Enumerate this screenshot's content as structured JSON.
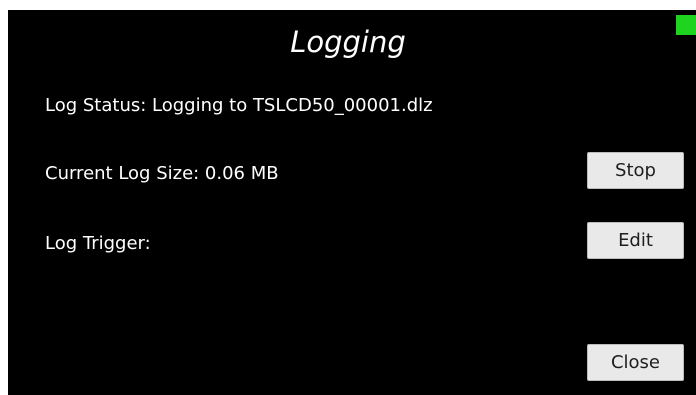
{
  "screen": {
    "title": "Logging",
    "status_led_color": "#1ed41e"
  },
  "rows": {
    "log_status": "Log Status:  Logging to TSLCD50_00001.dlz",
    "current_log_size": "Current Log Size: 0.06 MB",
    "log_trigger": "Log Trigger:"
  },
  "buttons": {
    "stop": "Stop",
    "edit": "Edit",
    "close": "Close"
  }
}
